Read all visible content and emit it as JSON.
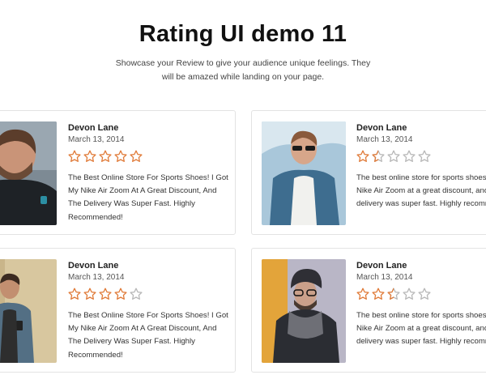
{
  "header": {
    "title": "Rating UI demo 11",
    "subtitle": "Showcase your Review to give your audience unique feelings. They will be amazed while landing on your page."
  },
  "colors": {
    "star": "#e07b39",
    "star_empty": "#b8b8b8"
  },
  "cards": [
    {
      "name": "Devon Lane",
      "date": "March 13, 2014",
      "rating": 5,
      "review": "The Best Online Store For Sports Shoes! I Got My Nike Air Zoom At A Great Discount, And The Delivery Was Super Fast. Highly Recommended!"
    },
    {
      "name": "Devon Lane",
      "date": "March 13, 2014",
      "rating": 1.5,
      "review": "The best online store for sports shoes! I got my Nike Air Zoom at a great discount, and the delivery was super fast. Highly recommended!"
    },
    {
      "name": "Devon Lane",
      "date": "March 13, 2014",
      "rating": 4,
      "review": "The Best Online Store For Sports Shoes! I Got My Nike Air Zoom At A Great Discount, And The Delivery Was Super Fast. Highly Recommended!"
    },
    {
      "name": "Devon Lane",
      "date": "March 13, 2014",
      "rating": 2.5,
      "review": "The best online store for sports shoes! I got my Nike Air Zoom at a great discount, and the delivery was super fast. Highly recommended!"
    }
  ]
}
